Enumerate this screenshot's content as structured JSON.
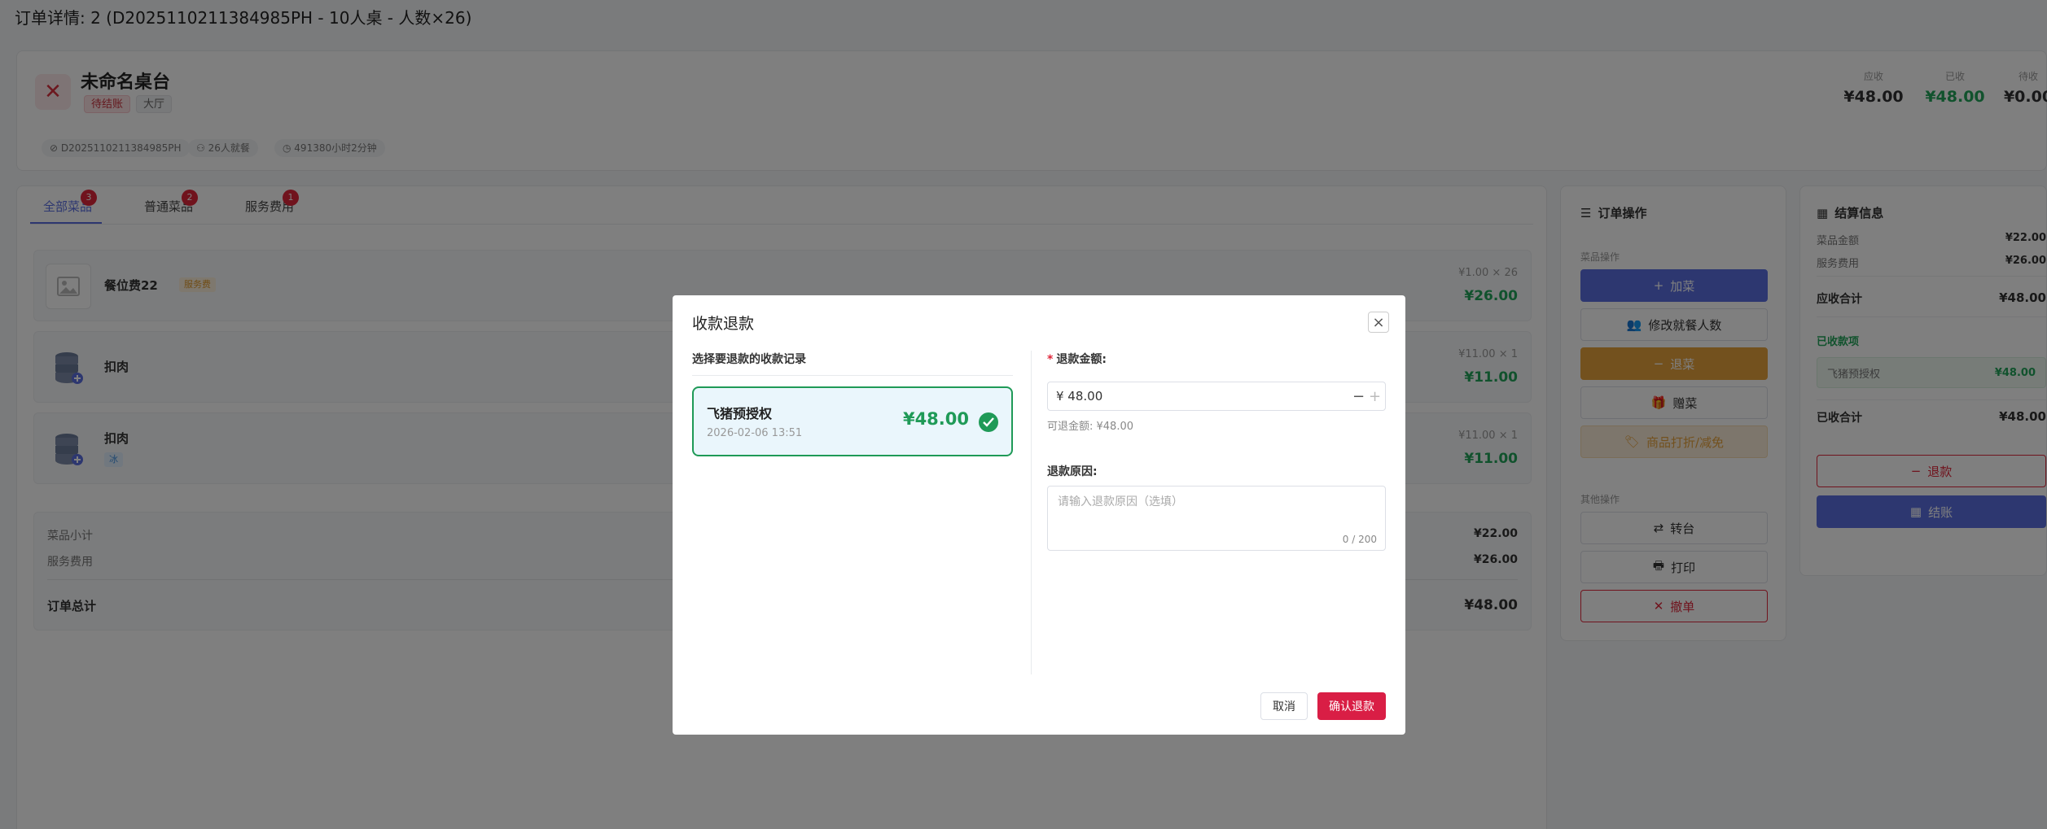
{
  "page": {
    "title": "订单详情: 2 (D2025110211384985PH - 10人桌 - 人数×26)"
  },
  "header": {
    "table_name": "未命名桌台",
    "status_tag": "待结账",
    "area_tag": "大厅",
    "order_no": "D2025110211384985PH",
    "guests": "26人就餐",
    "duration": "491380小时2分钟",
    "amounts": [
      {
        "label": "应收",
        "value": "¥48.00"
      },
      {
        "label": "已收",
        "value": "¥48.00"
      },
      {
        "label": "待收",
        "value": "¥0.00"
      }
    ]
  },
  "tabs": [
    {
      "label": "全部菜品",
      "badge": "3"
    },
    {
      "label": "普通菜品",
      "badge": "2"
    },
    {
      "label": "服务费用",
      "badge": "1"
    }
  ],
  "items": [
    {
      "name": "餐位费22",
      "tag": "服务费",
      "unit": "¥1.00 × 26",
      "price": "¥26.00"
    },
    {
      "name": "扣肉",
      "tag": "",
      "unit": "¥11.00 × 1",
      "price": "¥11.00"
    },
    {
      "name": "扣肉",
      "tag": "冰",
      "unit": "¥11.00 × 1",
      "price": "¥11.00"
    }
  ],
  "summary": {
    "subtotal_label": "菜品小计",
    "subtotal": "¥22.00",
    "service_label": "服务费用",
    "service": "¥26.00",
    "total_label": "订单总计",
    "total": "¥48.00"
  },
  "ops": {
    "title": "订单操作",
    "dish_section": "菜品操作",
    "add": "加菜",
    "guests": "修改就餐人数",
    "return": "退菜",
    "gift": "赠菜",
    "discount": "商品打折/减免",
    "other_section": "其他操作",
    "transfer": "转台",
    "print": "打印",
    "cancel_order": "撤单"
  },
  "settle": {
    "title": "结算信息",
    "dish_amount_label": "菜品金额",
    "dish_amount": "¥22.00",
    "service_label": "服务费用",
    "service": "¥26.00",
    "receivable_label": "应收合计",
    "receivable": "¥48.00",
    "paid_section": "已收款项",
    "paid_item_label": "飞猪预授权",
    "paid_item_amount": "¥48.00",
    "paid_total_label": "已收合计",
    "paid_total": "¥48.00",
    "refund_btn": "退款",
    "checkout_btn": "结账"
  },
  "modal": {
    "title": "收款退款",
    "left_title": "选择要退款的收款记录",
    "record": {
      "name": "飞猪预授权",
      "time": "2026-02-06 13:51",
      "amount": "¥48.00"
    },
    "amount_label": "退款金额:",
    "amount_value": "¥ 48.00",
    "refundable": "可退金额: ¥48.00",
    "reason_label": "退款原因:",
    "reason_placeholder": "请输入退款原因（选填）",
    "counter": "0 / 200",
    "cancel": "取消",
    "confirm": "确认退款"
  },
  "colors": {
    "primary": "#5b6ee1",
    "success": "#22a55a",
    "danger": "#d91e45",
    "warning": "#e6a23c"
  }
}
